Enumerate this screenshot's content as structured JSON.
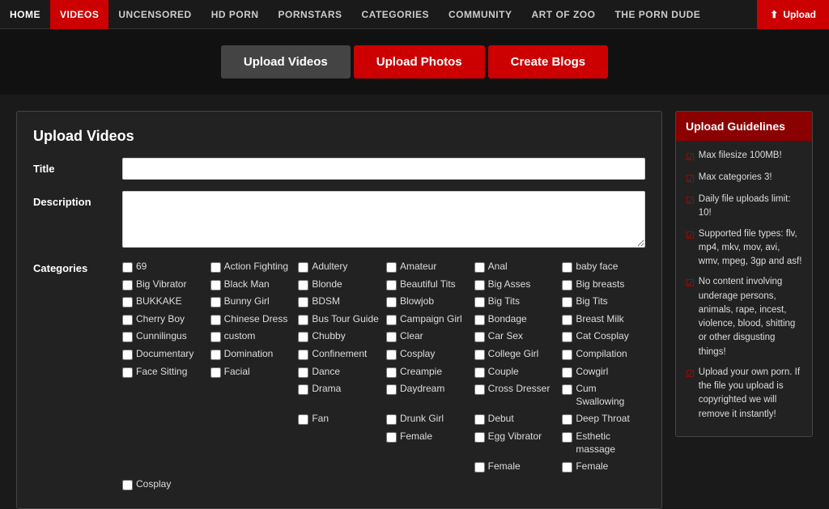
{
  "nav": {
    "items": [
      {
        "label": "HOME",
        "active": false
      },
      {
        "label": "VIDEOS",
        "active": true
      },
      {
        "label": "UNCENSORED",
        "active": false
      },
      {
        "label": "HD PORN",
        "active": false
      },
      {
        "label": "PORNSTARS",
        "active": false
      },
      {
        "label": "CATEGORIES",
        "active": false
      },
      {
        "label": "COMMUNITY",
        "active": false
      },
      {
        "label": "ART OF ZOO",
        "active": false
      },
      {
        "label": "THE PORN DUDE",
        "active": false
      }
    ],
    "upload_label": "Upload"
  },
  "tabs": [
    {
      "label": "Upload Videos",
      "active": false
    },
    {
      "label": "Upload Photos",
      "active": true
    },
    {
      "label": "Create Blogs",
      "active": true
    }
  ],
  "form": {
    "title": "Upload Videos",
    "title_label": "Title",
    "description_label": "Description",
    "categories_label": "Categories",
    "title_placeholder": "",
    "description_placeholder": ""
  },
  "categories": [
    "69",
    "Action Fighting",
    "Adultery",
    "Amateur",
    "Anal",
    "baby face",
    "Big Vibrator",
    "Black Man",
    "Blonde",
    "Beautiful Tits",
    "Big Asses",
    "Big breasts",
    "BUKKAKE",
    "Bunny Girl",
    "BDSM",
    "Blowjob",
    "Big Tits",
    "Big Tits",
    "Cherry Boy",
    "Chinese Dress",
    "Bus Tour Guide",
    "Campaign Girl",
    "Bondage",
    "Breast Milk",
    "Cunnilingus",
    "custom",
    "Chubby",
    "Clear",
    "Car Sex",
    "Cat Cosplay",
    "Documentary",
    "Domination",
    "Confinement",
    "Cosplay",
    "College Girl",
    "Compilation",
    "Face Sitting",
    "Facial",
    "Dance",
    "Creampie",
    "Couple",
    "Cowgirl",
    "",
    "",
    "Drama",
    "Daydream",
    "Cross Dresser",
    "Cum Swallowing",
    "",
    "",
    "Fan",
    "Drunk Girl",
    "Debut",
    "Deep Throat",
    "",
    "",
    "",
    "Female",
    "Egg Vibrator",
    "Esthetic massage",
    "",
    "",
    "",
    "",
    "Female",
    "Female",
    "Cosplay",
    "",
    "",
    "",
    "",
    ""
  ],
  "guidelines": {
    "header": "Upload Guidelines",
    "items": [
      "Max filesize 100MB!",
      "Max categories 3!",
      "Daily file uploads limit: 10!",
      "Supported file types: flv, mp4, mkv, mov, avi, wmv, mpeg, 3gp and asf!",
      "No content involving underage persons, animals, rape, incest, violence, blood, shitting or other disgusting things!",
      "Upload your own porn. If the file you upload is copyrighted we will remove it instantly!"
    ]
  }
}
